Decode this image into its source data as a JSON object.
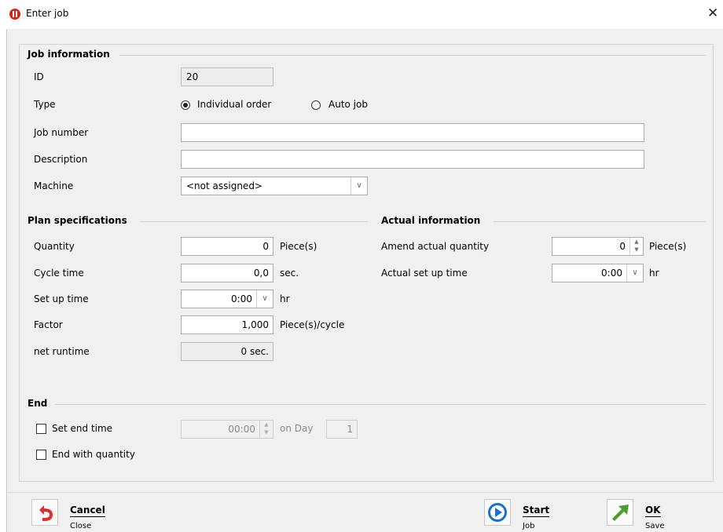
{
  "window": {
    "title": "Enter job",
    "close": "✕"
  },
  "job_info": {
    "section_title": "Job information",
    "id_label": "ID",
    "id_value": "20",
    "type_label": "Type",
    "type_options": [
      "Individual order",
      "Auto job"
    ],
    "type_selected": "Individual order",
    "job_number_label": "Job number",
    "job_number_value": "",
    "description_label": "Description",
    "description_value": "",
    "machine_label": "Machine",
    "machine_value": "<not assigned>"
  },
  "plan": {
    "section_title": "Plan specifications",
    "quantity_label": "Quantity",
    "quantity_value": "0",
    "quantity_unit": "Piece(s)",
    "cycle_label": "Cycle time",
    "cycle_value": "0,0",
    "cycle_unit": "sec.",
    "setup_label": "Set up time",
    "setup_value": "0:00",
    "setup_unit": "hr",
    "factor_label": "Factor",
    "factor_value": "1,000",
    "factor_unit": "Piece(s)/cycle",
    "net_label": "net runtime",
    "net_value": "0 sec."
  },
  "actual": {
    "section_title": "Actual information",
    "amend_label": "Amend actual quantity",
    "amend_value": "0",
    "amend_unit": "Piece(s)",
    "setup_label": "Actual set up time",
    "setup_value": "0:00",
    "setup_unit": "hr"
  },
  "end": {
    "section_title": "End",
    "set_end_label": "Set end time",
    "set_end_checked": false,
    "end_time_value": "00:00",
    "on_day_label": "on Day",
    "day_value": "1",
    "end_qty_label": "End with quantity",
    "end_qty_checked": false
  },
  "footer": {
    "cancel": {
      "title": "Cancel",
      "sub": "Close"
    },
    "start": {
      "title": "Start",
      "sub": "Job"
    },
    "ok": {
      "title": "OK",
      "sub": "Save"
    }
  },
  "icons": {
    "cancel": "undo-arrow-icon",
    "start": "play-icon",
    "ok": "check-arrow-icon",
    "app": "app-logo-icon"
  },
  "colors": {
    "cancel_red": "#d9322a",
    "start_blue": "#1a6fd1",
    "ok_green": "#4aa02c",
    "app_red": "#d8231b"
  }
}
